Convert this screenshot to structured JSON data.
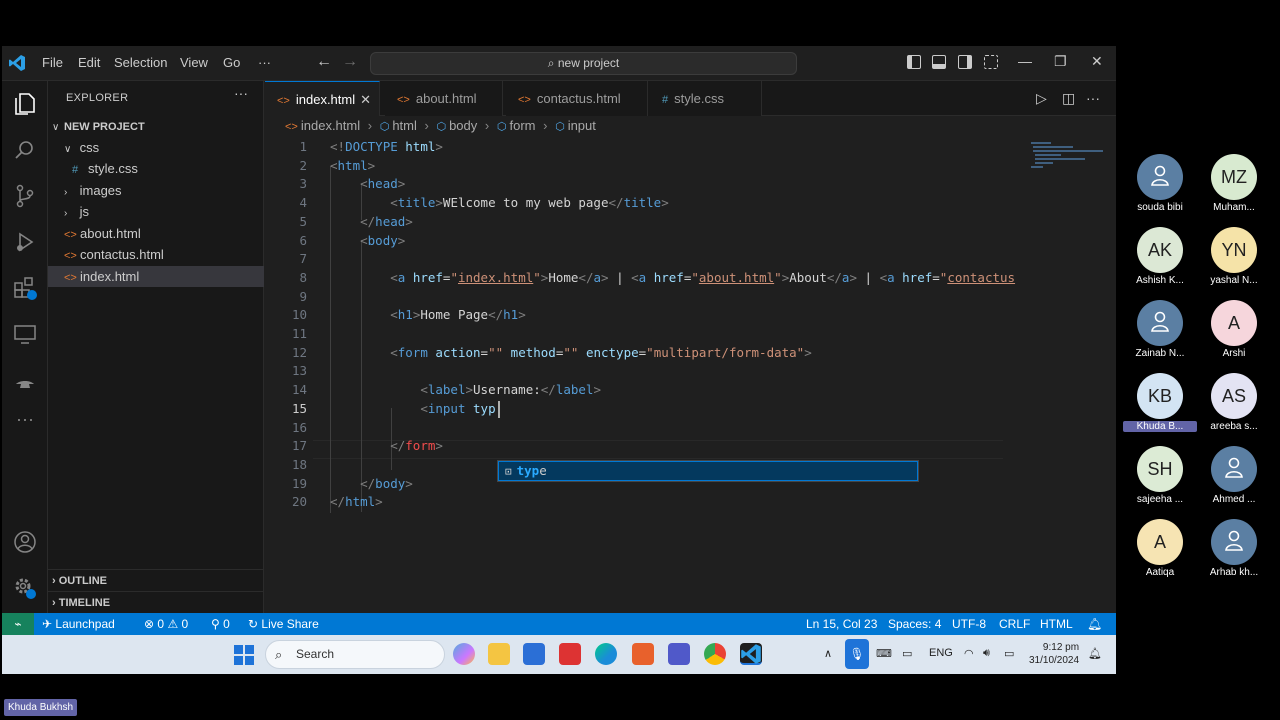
{
  "titlebar": {
    "menus": [
      "File",
      "Edit",
      "Selection",
      "View",
      "Go"
    ],
    "more": "···",
    "command_center": "new project"
  },
  "sidebar": {
    "title": "EXPLORER",
    "more": "···",
    "project": "NEW PROJECT",
    "tree": [
      {
        "label": "css",
        "type": "folder",
        "expanded": true,
        "depth": 1
      },
      {
        "label": "style.css",
        "type": "css",
        "depth": 2
      },
      {
        "label": "images",
        "type": "folder",
        "expanded": false,
        "depth": 1
      },
      {
        "label": "js",
        "type": "folder",
        "expanded": false,
        "depth": 1
      },
      {
        "label": "about.html",
        "type": "html",
        "depth": 1
      },
      {
        "label": "contactus.html",
        "type": "html",
        "depth": 1
      },
      {
        "label": "index.html",
        "type": "html",
        "depth": 1,
        "selected": true
      }
    ],
    "outline": "OUTLINE",
    "timeline": "TIMELINE"
  },
  "tabs": [
    {
      "label": "index.html",
      "type": "html",
      "active": true
    },
    {
      "label": "about.html",
      "type": "html"
    },
    {
      "label": "contactus.html",
      "type": "html"
    },
    {
      "label": "style.css",
      "type": "css"
    }
  ],
  "breadcrumb": [
    "index.html",
    "html",
    "body",
    "form",
    "input"
  ],
  "editor": {
    "line_numbers": [
      "1",
      "2",
      "3",
      "4",
      "5",
      "6",
      "7",
      "8",
      "9",
      "10",
      "11",
      "12",
      "13",
      "14",
      "15",
      "16",
      "17",
      "18",
      "19",
      "20"
    ],
    "current_line": 15,
    "suggestion": {
      "match": "typ",
      "rest": "e"
    }
  },
  "statusbar": {
    "launchpad": "Launchpad",
    "errors": "0",
    "warnings": "0",
    "ports": "0",
    "live_share": "Live Share",
    "cursor": "Ln 15, Col 23",
    "spaces": "Spaces: 4",
    "encoding": "UTF-8",
    "eol": "CRLF",
    "language": "HTML"
  },
  "taskbar": {
    "search": "Search",
    "lang": "ENG",
    "time": "9:12 pm",
    "date": "31/10/2024"
  },
  "participants": [
    {
      "initials": "",
      "name": "souda bibi",
      "color": "#5b7fa3"
    },
    {
      "initials": "MZ",
      "name": "Muham...",
      "color": "#d8ead0"
    },
    {
      "initials": "AK",
      "name": "Ashish K...",
      "color": "#dce8d5"
    },
    {
      "initials": "YN",
      "name": "yashal N...",
      "color": "#f5e3a8"
    },
    {
      "initials": "",
      "name": "Zainab N...",
      "color": "#5b7fa3"
    },
    {
      "initials": "A",
      "name": "Arshi",
      "color": "#f6d6dc"
    },
    {
      "initials": "KB",
      "name": "Khuda B...",
      "color": "#d3e4f3"
    },
    {
      "initials": "AS",
      "name": "areeba s...",
      "color": "#e3e3f3"
    },
    {
      "initials": "SH",
      "name": "sajeeha ...",
      "color": "#dcebd5"
    },
    {
      "initials": "",
      "name": "Ahmed ...",
      "color": "#5b7fa3"
    },
    {
      "initials": "A",
      "name": "Aatiqa",
      "color": "#f6e4b3"
    },
    {
      "initials": "",
      "name": "Arhab kh...",
      "color": "#5b7fa3"
    }
  ],
  "presenter": "Khuda Bukhsh"
}
